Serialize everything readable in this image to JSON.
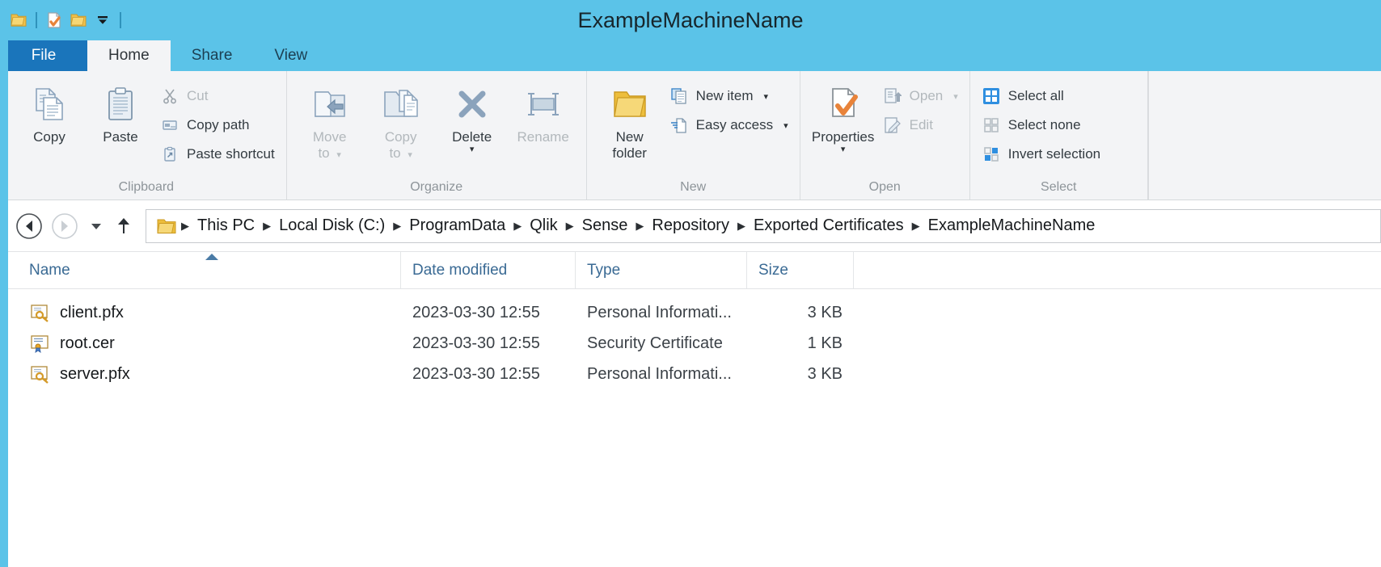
{
  "window": {
    "title": "ExampleMachineName",
    "titlebar_color": "#5bc3e8",
    "accent_color": "#1a75bb"
  },
  "quick_access": {
    "items": [
      {
        "name": "folder-icon",
        "label": "Folder"
      },
      {
        "name": "properties-icon",
        "label": "Properties"
      },
      {
        "name": "new-folder-icon",
        "label": "New folder"
      },
      {
        "name": "customize-quick-access-icon",
        "label": "Customize Quick Access Toolbar"
      }
    ]
  },
  "tabs": [
    {
      "label": "File",
      "kind": "file"
    },
    {
      "label": "Home",
      "kind": "active"
    },
    {
      "label": "Share",
      "kind": "normal"
    },
    {
      "label": "View",
      "kind": "normal"
    }
  ],
  "ribbon": {
    "groups": [
      {
        "label": "Clipboard",
        "big": [
          {
            "label": "Copy",
            "icon": "copy-icon",
            "enabled": true
          },
          {
            "label": "Paste",
            "icon": "paste-icon",
            "enabled": true
          }
        ],
        "small": [
          {
            "label": "Cut",
            "icon": "cut-icon",
            "enabled": false
          },
          {
            "label": "Copy path",
            "icon": "copy-path-icon",
            "enabled": false
          },
          {
            "label": "Paste shortcut",
            "icon": "paste-shortcut-icon",
            "enabled": false
          }
        ]
      },
      {
        "label": "Organize",
        "big": [
          {
            "label": "Move\nto",
            "icon": "move-to-icon",
            "enabled": false,
            "caret": true
          },
          {
            "label": "Copy\nto",
            "icon": "copy-to-icon",
            "enabled": false,
            "caret": true
          },
          {
            "label": "Delete",
            "icon": "delete-icon",
            "enabled": true,
            "caret_below": true
          },
          {
            "label": "Rename",
            "icon": "rename-icon",
            "enabled": false
          }
        ],
        "small": []
      },
      {
        "label": "New",
        "big": [
          {
            "label": "New\nfolder",
            "icon": "new-folder-icon",
            "enabled": true
          }
        ],
        "small": [
          {
            "label": "New item",
            "icon": "new-item-icon",
            "enabled": true,
            "caret": true
          },
          {
            "label": "Easy access",
            "icon": "easy-access-icon",
            "enabled": true,
            "caret": true
          }
        ]
      },
      {
        "label": "Open",
        "big": [
          {
            "label": "Properties",
            "icon": "properties-icon",
            "enabled": true,
            "caret_below": true
          }
        ],
        "small": [
          {
            "label": "Open",
            "icon": "open-icon",
            "enabled": false,
            "caret": true
          },
          {
            "label": "Edit",
            "icon": "edit-icon",
            "enabled": false
          }
        ]
      },
      {
        "label": "Select",
        "big": [],
        "small": [
          {
            "label": "Select all",
            "icon": "select-all-icon",
            "enabled": true
          },
          {
            "label": "Select none",
            "icon": "select-none-icon",
            "enabled": true
          },
          {
            "label": "Invert selection",
            "icon": "invert-selection-icon",
            "enabled": true
          }
        ]
      }
    ]
  },
  "navigation": {
    "back": {
      "name": "back-arrow-icon",
      "enabled": true
    },
    "forward": {
      "name": "forward-arrow-icon",
      "enabled": false
    },
    "recent": {
      "name": "chevron-down-icon",
      "enabled": true
    },
    "up": {
      "name": "up-arrow-icon",
      "enabled": true
    },
    "breadcrumb_icon": "folder-icon",
    "breadcrumb": [
      "This PC",
      "Local Disk (C:)",
      "ProgramData",
      "Qlik",
      "Sense",
      "Repository",
      "Exported Certificates",
      "ExampleMachineName"
    ]
  },
  "filelist": {
    "columns": [
      {
        "label": "Name",
        "sorted": "asc"
      },
      {
        "label": "Date modified",
        "sorted": null
      },
      {
        "label": "Type",
        "sorted": null
      },
      {
        "label": "Size",
        "sorted": null
      }
    ],
    "rows": [
      {
        "name": "client.pfx",
        "icon": "pfx-certificate-key-icon",
        "date": "2023-03-30 12:55",
        "type": "Personal Informati...",
        "size": "3 KB"
      },
      {
        "name": "root.cer",
        "icon": "cer-certificate-icon",
        "date": "2023-03-30 12:55",
        "type": "Security Certificate",
        "size": "1 KB"
      },
      {
        "name": "server.pfx",
        "icon": "pfx-certificate-key-icon",
        "date": "2023-03-30 12:55",
        "type": "Personal Informati...",
        "size": "3 KB"
      }
    ]
  }
}
